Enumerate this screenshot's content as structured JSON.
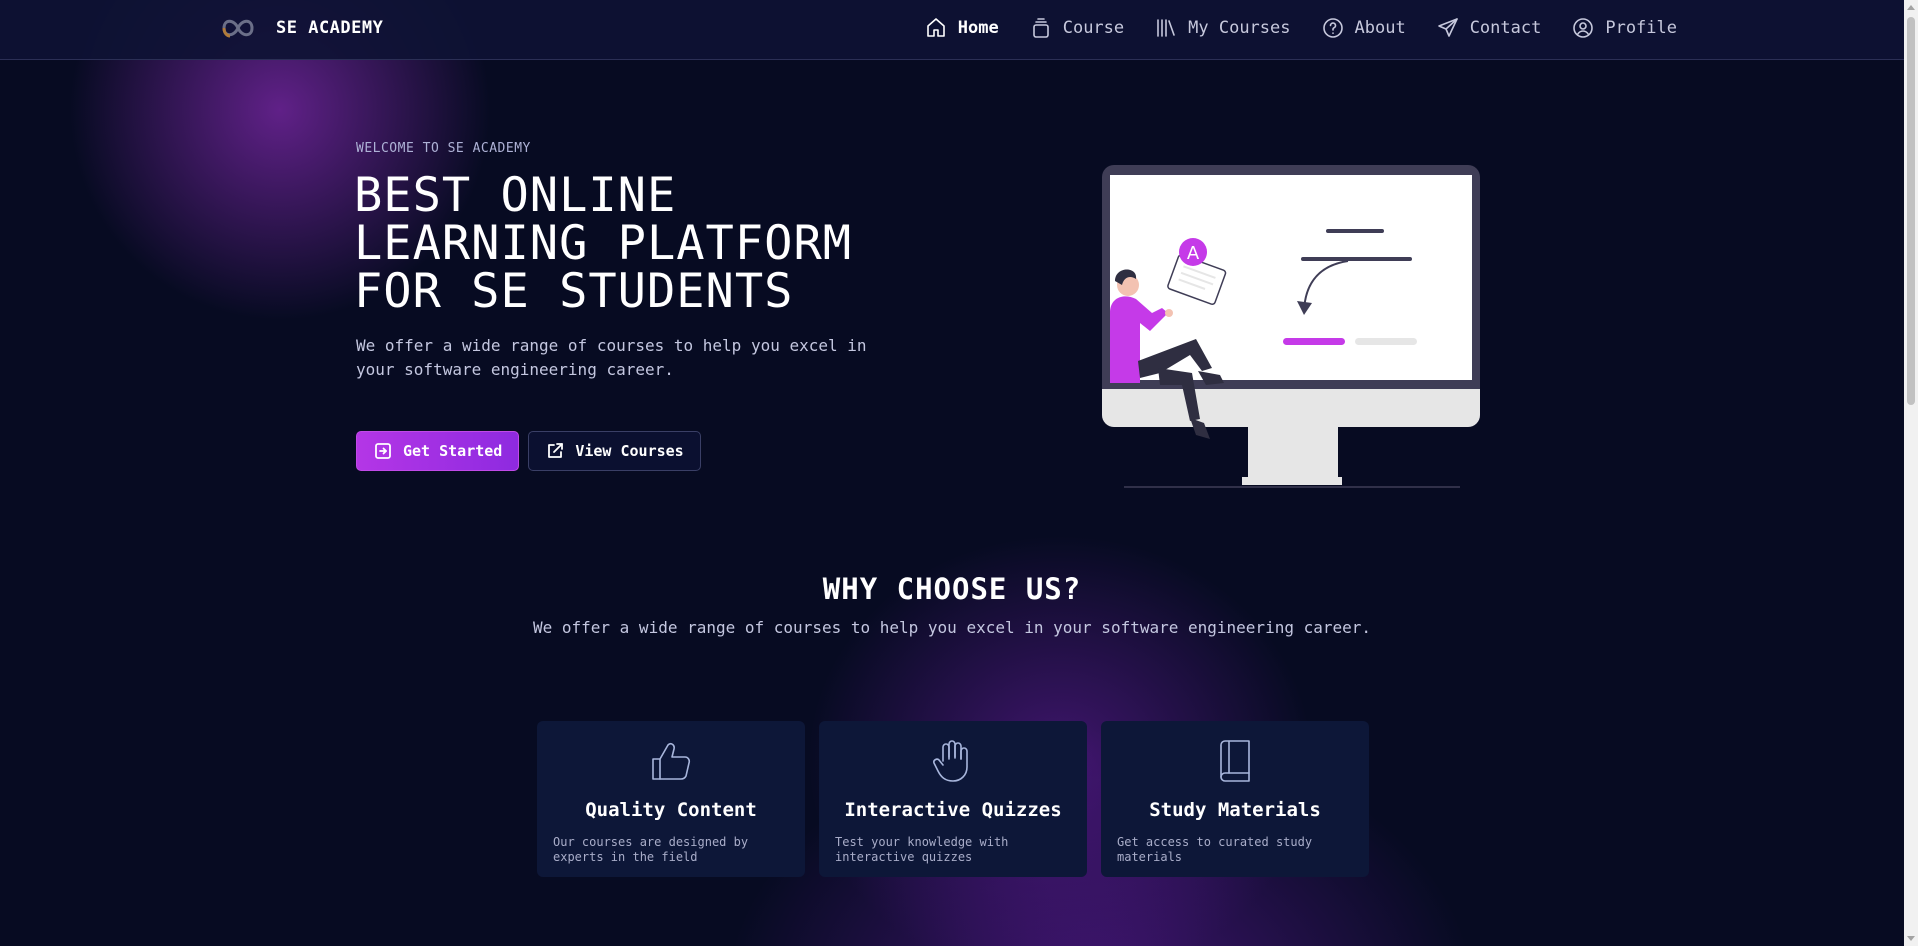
{
  "brand": {
    "name": "SE ACADEMY",
    "logo_icon": "infinity-logo"
  },
  "nav": {
    "items": [
      {
        "label": "Home",
        "icon": "home-icon",
        "active": true
      },
      {
        "label": "Course",
        "icon": "layers-icon",
        "active": false
      },
      {
        "label": "My Courses",
        "icon": "library-icon",
        "active": false
      },
      {
        "label": "About",
        "icon": "help-circle-icon",
        "active": false
      },
      {
        "label": "Contact",
        "icon": "send-icon",
        "active": false
      },
      {
        "label": "Profile",
        "icon": "user-circle-icon",
        "active": false
      }
    ]
  },
  "hero": {
    "eyebrow": "WELCOME TO SE ACADEMY",
    "title": "BEST ONLINE LEARNING PLATFORM FOR SE STUDENTS",
    "subtitle": "We offer a wide range of courses to help you excel in your software engineering career.",
    "primary_button": "Get Started",
    "secondary_button": "View Courses",
    "illustration_letter": "A"
  },
  "why": {
    "title": "WHY CHOOSE US?",
    "subtitle": "We offer a wide range of courses to help you excel in your software engineering career."
  },
  "features": [
    {
      "title": "Quality Content",
      "description": "Our courses are designed by experts in the field",
      "icon": "thumbs-up-icon"
    },
    {
      "title": "Interactive Quizzes",
      "description": "Test your knowledge with interactive quizzes",
      "icon": "hand-icon"
    },
    {
      "title": "Study Materials",
      "description": "Get access to curated study materials",
      "icon": "book-icon"
    }
  ],
  "colors": {
    "background": "#070b22",
    "accent": "#b436e6",
    "card": "#0d1738",
    "navbar": "#0e1234"
  }
}
